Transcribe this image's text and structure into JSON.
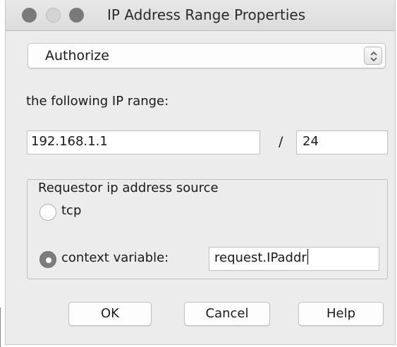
{
  "window": {
    "title": "IP Address Range Properties"
  },
  "mode_select": {
    "value": "Authorize"
  },
  "range": {
    "label": "the following IP range:",
    "ip_value": "192.168.1.1",
    "separator": "/",
    "mask_value": "24"
  },
  "source_group": {
    "legend": "Requestor ip address source",
    "options": [
      {
        "label": "tcp",
        "selected": false
      },
      {
        "label": "context variable:",
        "selected": true
      }
    ],
    "context_variable_value": "request.IPaddr"
  },
  "buttons": {
    "ok": "OK",
    "cancel": "Cancel",
    "help": "Help"
  },
  "icons": {
    "close": "close-traffic-light-icon",
    "minimize": "minimize-traffic-light-icon",
    "maximize": "maximize-traffic-light-icon",
    "select_arrows": "up-down-chevron-icon"
  }
}
